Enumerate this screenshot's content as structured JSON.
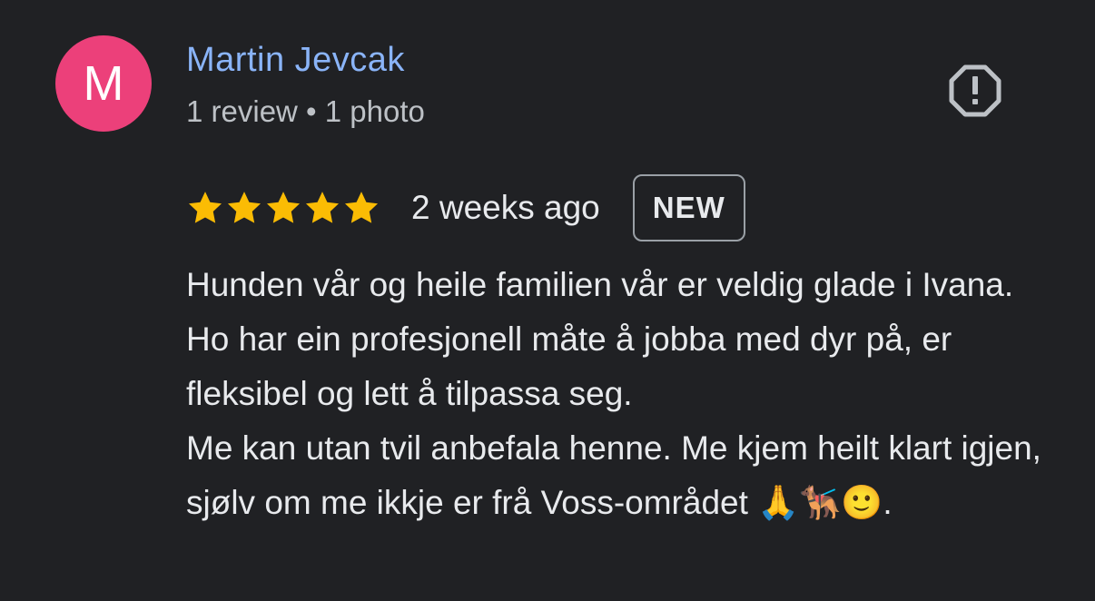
{
  "author": {
    "initial": "M",
    "avatar_color": "#ec407a",
    "name": "Martin Jevcak",
    "name_color": "#8ab4f8",
    "meta": "1 review • 1 photo"
  },
  "report": {
    "icon": "report-flag-octagon-icon"
  },
  "rating": {
    "stars": 5,
    "max_stars": 5,
    "star_color": "#fbbc04",
    "date": "2 weeks ago",
    "badge": "NEW"
  },
  "review": {
    "text": "Hunden vår og heile familien vår er veldig glade i Ivana. Ho har ein profesjonell måte å jobba med dyr på, er fleksibel og lett å tilpassa seg.\nMe kan utan tvil anbefala henne. Me kjem heilt klart igjen, sjølv om me ikkje er frå Voss-området 🙏🐕‍🦺🙂."
  }
}
